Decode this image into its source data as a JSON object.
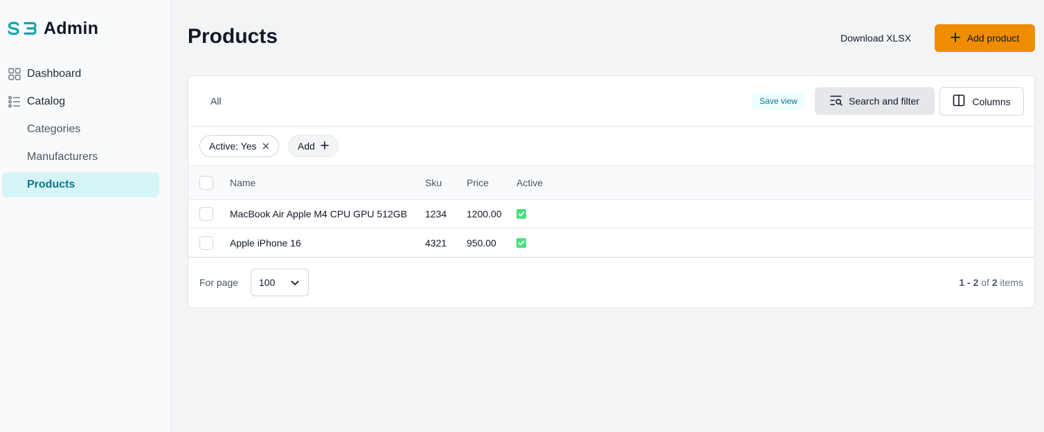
{
  "app": {
    "logo_mark": "SB",
    "title": "Admin",
    "brand_color": "#14a3a8",
    "accent_color": "#f08c00"
  },
  "sidebar": {
    "items": [
      {
        "label": "Dashboard",
        "icon": "grid-icon"
      },
      {
        "label": "Catalog",
        "icon": "list-icon"
      },
      {
        "label": "Categories"
      },
      {
        "label": "Manufacturers"
      },
      {
        "label": "Products",
        "active": true
      }
    ]
  },
  "header": {
    "title": "Products",
    "download_label": "Download XLSX",
    "add_label": "Add product"
  },
  "toolbar": {
    "tab_all": "All",
    "save_view": "Save view",
    "search_filter": "Search and filter",
    "columns": "Columns"
  },
  "filters": {
    "active_chip": "Active: Yes",
    "add_chip": "Add"
  },
  "table": {
    "columns": [
      "Name",
      "Sku",
      "Price",
      "Active"
    ],
    "rows": [
      {
        "name": "MacBook Air Apple M4 CPU GPU 512GB",
        "sku": "1234",
        "price": "1200.00",
        "active": true
      },
      {
        "name": "Apple iPhone 16",
        "sku": "4321",
        "price": "950.00",
        "active": true
      }
    ]
  },
  "pagination": {
    "for_page_label": "For page",
    "per_page": "100",
    "range": "1 - 2",
    "of": "of",
    "total": "2",
    "items": "items"
  }
}
